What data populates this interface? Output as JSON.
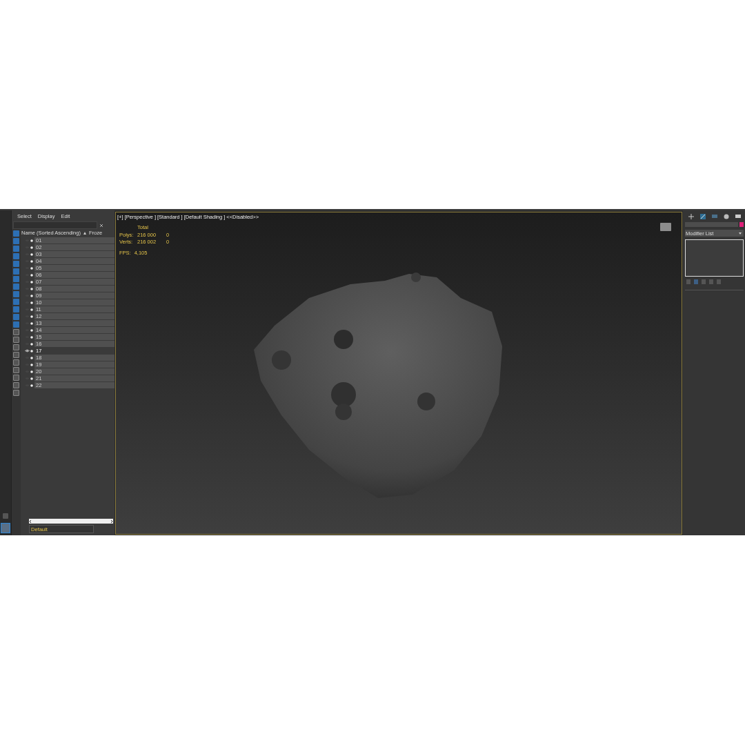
{
  "explorer": {
    "menu": [
      {
        "label": "Select"
      },
      {
        "label": "Display"
      },
      {
        "label": "Edit"
      }
    ],
    "columns": [
      {
        "label": "Name (Sorted Ascending)"
      },
      {
        "label": "Froze"
      }
    ],
    "rows": [
      {
        "name": "01",
        "selected": false
      },
      {
        "name": "02",
        "selected": false
      },
      {
        "name": "03",
        "selected": false
      },
      {
        "name": "04",
        "selected": false
      },
      {
        "name": "05",
        "selected": false
      },
      {
        "name": "06",
        "selected": false
      },
      {
        "name": "07",
        "selected": false
      },
      {
        "name": "08",
        "selected": false
      },
      {
        "name": "09",
        "selected": false
      },
      {
        "name": "10",
        "selected": false
      },
      {
        "name": "11",
        "selected": false
      },
      {
        "name": "12",
        "selected": false
      },
      {
        "name": "13",
        "selected": false
      },
      {
        "name": "14",
        "selected": false
      },
      {
        "name": "15",
        "selected": false
      },
      {
        "name": "16",
        "selected": false
      },
      {
        "name": "17",
        "selected": true
      },
      {
        "name": "18",
        "selected": false
      },
      {
        "name": "19",
        "selected": false
      },
      {
        "name": "20",
        "selected": false
      },
      {
        "name": "21",
        "selected": false
      },
      {
        "name": "22",
        "selected": false
      }
    ],
    "layer": "Default"
  },
  "viewport": {
    "labels": [
      "[+]",
      "[Perspective ]",
      "[Standard ]",
      "[Default Shading ]",
      "<<Disabled>>"
    ],
    "stats_header": "Total",
    "stats": [
      {
        "label": "Polys:",
        "total": "216 000",
        "selected": "0"
      },
      {
        "label": "Verts:",
        "total": "216 002",
        "selected": "0"
      }
    ],
    "fps": {
      "label": "FPS:",
      "value": "4,105"
    }
  },
  "command_panel": {
    "modifier_list": "Modifier List"
  }
}
